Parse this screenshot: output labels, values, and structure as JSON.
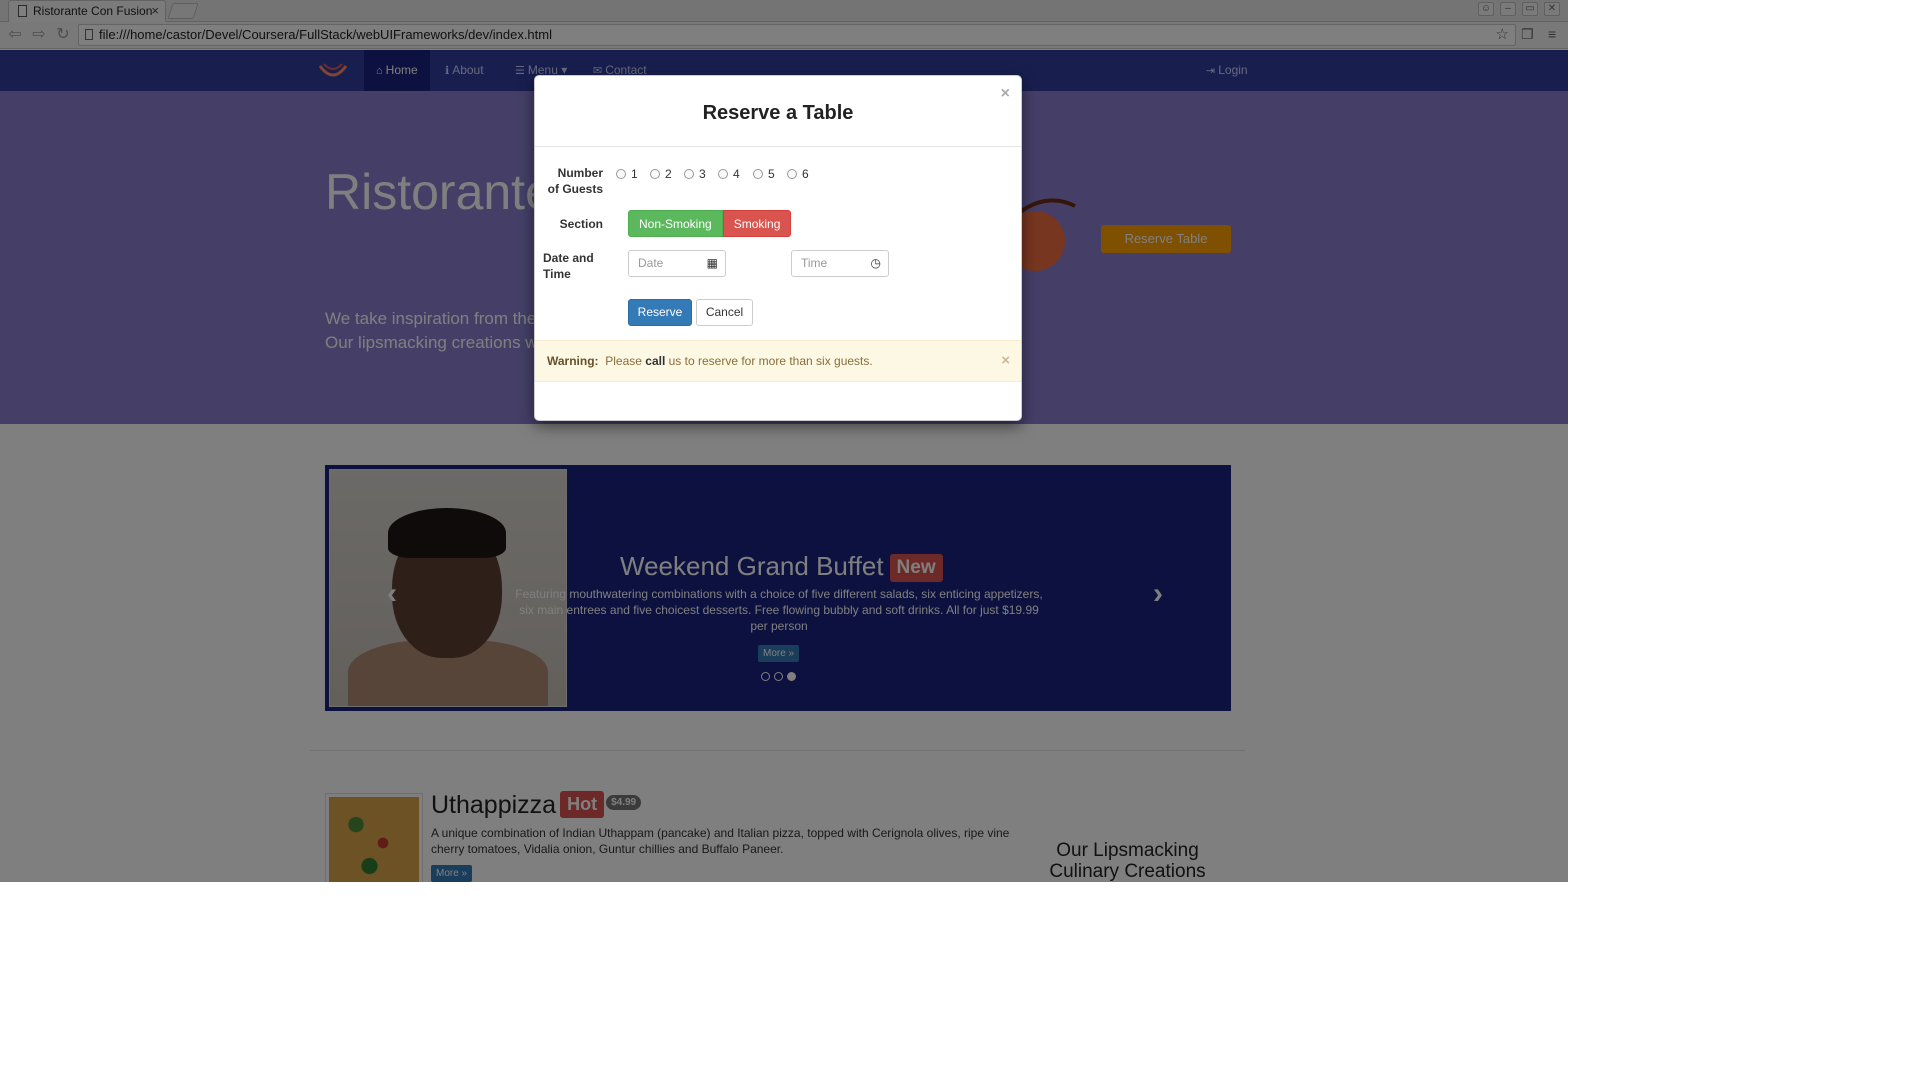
{
  "browser": {
    "tab_title": "Ristorante Con Fusion",
    "tab_close": "×",
    "url": "file:///home/castor/Devel/Coursera/FullStack/webUIFrameworks/dev/index.html"
  },
  "nav": {
    "items": [
      {
        "icon": "⌂",
        "label": "Home"
      },
      {
        "icon": "ℹ",
        "label": "About"
      },
      {
        "icon": "☰",
        "label": "Menu ▾"
      },
      {
        "icon": "✉",
        "label": "Contact"
      }
    ],
    "login": "Login",
    "login_icon": "⇥"
  },
  "jumbotron": {
    "title": "Ristorante Con Fusion",
    "text": "We take inspiration from the World's best cuisines, and create a unique fusion experience. Our lipsmacking creations will tickle your culinary senses!",
    "reserve_button": "Reserve Table"
  },
  "carousel": {
    "heading": "Weekend Grand Buffet",
    "label": "New",
    "description": "Featuring mouthwatering combinations with a choice of five different salads, six enticing appetizers, six main entrees and five choicest desserts. Free flowing bubbly and soft drinks. All for just $19.99 per person",
    "more": "More »",
    "prev": "‹",
    "next": "›"
  },
  "dish": {
    "name": "Uthappizza",
    "label": "Hot",
    "price": "$4.99",
    "description": "A unique combination of Indian Uthappam (pancake) and Italian pizza, topped with Cerignola olives, ripe vine cherry tomatoes, Vidalia onion, Guntur chillies and Buffalo Paneer.",
    "more": "More »"
  },
  "sidebar": {
    "heading": "Our Lipsmacking Culinary Creations"
  },
  "modal": {
    "title": "Reserve a Table",
    "close": "×",
    "guests_label_1": "Number",
    "guests_label_2": "of Guests",
    "guest_options": [
      "1",
      "2",
      "3",
      "4",
      "5",
      "6"
    ],
    "section_label": "Section",
    "section_options": [
      "Non-Smoking",
      "Smoking"
    ],
    "datetime_label_1": "Date and",
    "datetime_label_2": "Time",
    "date_placeholder": "Date",
    "time_placeholder": "Time",
    "reserve": "Reserve",
    "cancel": "Cancel",
    "alert": {
      "strong": "Warning:",
      "text_1": "Please",
      "text_bold": "call",
      "text_2": "us to reserve for more than six guests.",
      "close": "×"
    }
  },
  "colors": {
    "navbar": "#303f9f",
    "jumbotron": "#8a7fd0",
    "carousel": "#1a237e",
    "reserve_table": "#ffa000",
    "success": "#5cb85c",
    "danger": "#d9534f",
    "primary": "#337ab7",
    "warning_bg": "#fcf8e3"
  }
}
